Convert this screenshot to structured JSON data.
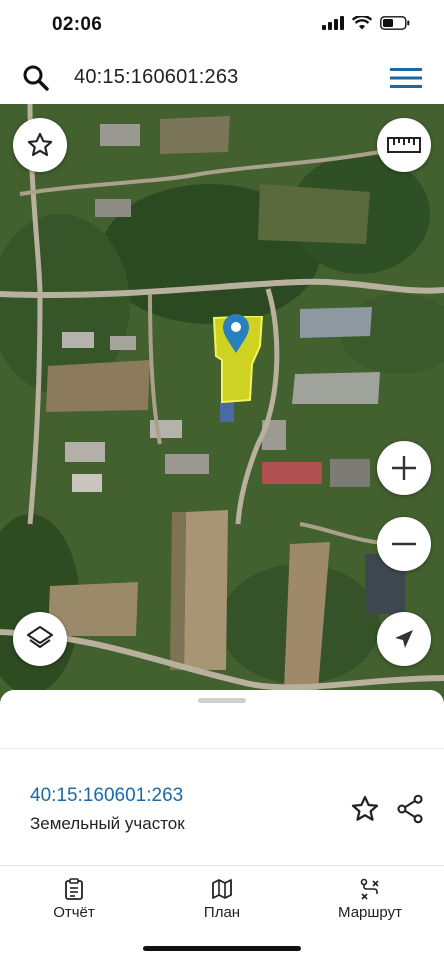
{
  "status_bar": {
    "time": "02:06",
    "icons": [
      "cellular-signal-icon",
      "wifi-icon",
      "battery-icon"
    ]
  },
  "search": {
    "icon": "search-icon",
    "query": "40:15:160601:263",
    "menu_icon": "hamburger-menu-icon"
  },
  "map": {
    "type": "satellite",
    "marker_icon": "map-pin-icon",
    "parcel_color": "#e6e620",
    "buttons": {
      "favorite": "star-icon",
      "ruler": "ruler-icon",
      "layers": "layers-icon",
      "zoom_in": "plus-icon",
      "zoom_out": "minus-icon",
      "locate": "navigation-arrow-icon"
    }
  },
  "sheet": {
    "cadastral_number": "40:15:160601:263",
    "object_type": "Земельный участок",
    "accent_color": "#1b6aa5"
  },
  "tabs": [
    {
      "label": "Отчёт",
      "icon": "report-icon"
    },
    {
      "label": "План",
      "icon": "map-plan-icon"
    },
    {
      "label": "Маршрут",
      "icon": "route-icon"
    }
  ]
}
